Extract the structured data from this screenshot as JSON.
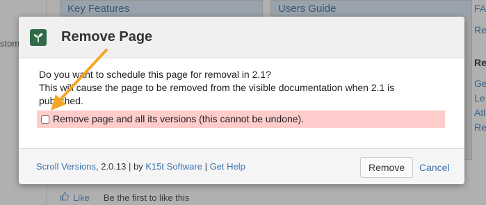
{
  "background": {
    "left_fragment": "stom",
    "panel_left_title": "Key Features",
    "panel_right_title": "Users Guide",
    "right_fragments": [
      "FA",
      "Re",
      "Re",
      "Ge",
      "Le",
      "Atl",
      "Re"
    ],
    "like_label": "Like",
    "first_like_text": "Be the first to like this"
  },
  "dialog": {
    "title": "Remove Page",
    "question": "Do you want to schedule this page for removal in 2.1?",
    "explanation": "This will cause the page to be removed from the visible documentation when 2.1 is published.",
    "checkbox_label": "Remove page and all its versions (this cannot be undone).",
    "checkbox_checked": false,
    "footer": {
      "product_link": "Scroll Versions",
      "version_text": ", 2.0.13 | by ",
      "vendor_link": "K15t Software",
      "separator": " | ",
      "help_link": "Get Help"
    },
    "remove_button": "Remove",
    "cancel_link": "Cancel"
  },
  "colors": {
    "accent_link": "#3b73af",
    "warning_bg": "#ffcccc",
    "arrow": "#f5a623"
  },
  "icons": {
    "app_icon": "leaf-app-icon",
    "arrow": "annotation-arrow-icon",
    "like": "thumbs-up-icon"
  }
}
